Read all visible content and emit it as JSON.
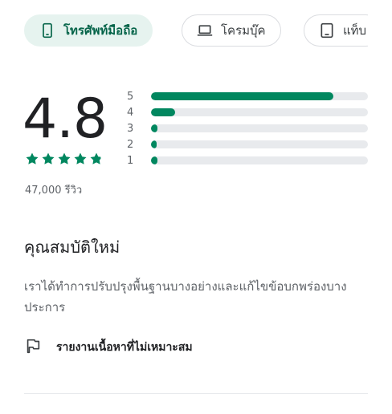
{
  "device_tabs": [
    {
      "label": "โทรศัพท์มือถือ",
      "icon": "phone-icon",
      "selected": true
    },
    {
      "label": "โครมบุ๊ค",
      "icon": "laptop-icon",
      "selected": false
    },
    {
      "label": "แท็บ",
      "icon": "tablet-icon",
      "selected": false
    }
  ],
  "ratings": {
    "average": "4.8",
    "stars_value": 4.8,
    "review_count": "47,000 รีวิว",
    "distribution": [
      {
        "label": "5",
        "fraction": 0.84
      },
      {
        "label": "4",
        "fraction": 0.11
      },
      {
        "label": "3",
        "fraction": 0.03
      },
      {
        "label": "2",
        "fraction": 0.01
      },
      {
        "label": "1",
        "fraction": 0.03
      }
    ]
  },
  "whats_new": {
    "title": "คุณสมบัติใหม่",
    "body": "เราได้ทำการปรับปรุงพื้นฐานบางอย่างและแก้ไขข้อบกพร่องบางประการ"
  },
  "report": {
    "label": "รายงานเนื้อหาที่ไม่เหมาะสม",
    "icon": "flag-icon"
  },
  "colors": {
    "accent": "#01875f",
    "chip_selected_bg": "#e6f3ef",
    "track": "#e8eaed"
  }
}
